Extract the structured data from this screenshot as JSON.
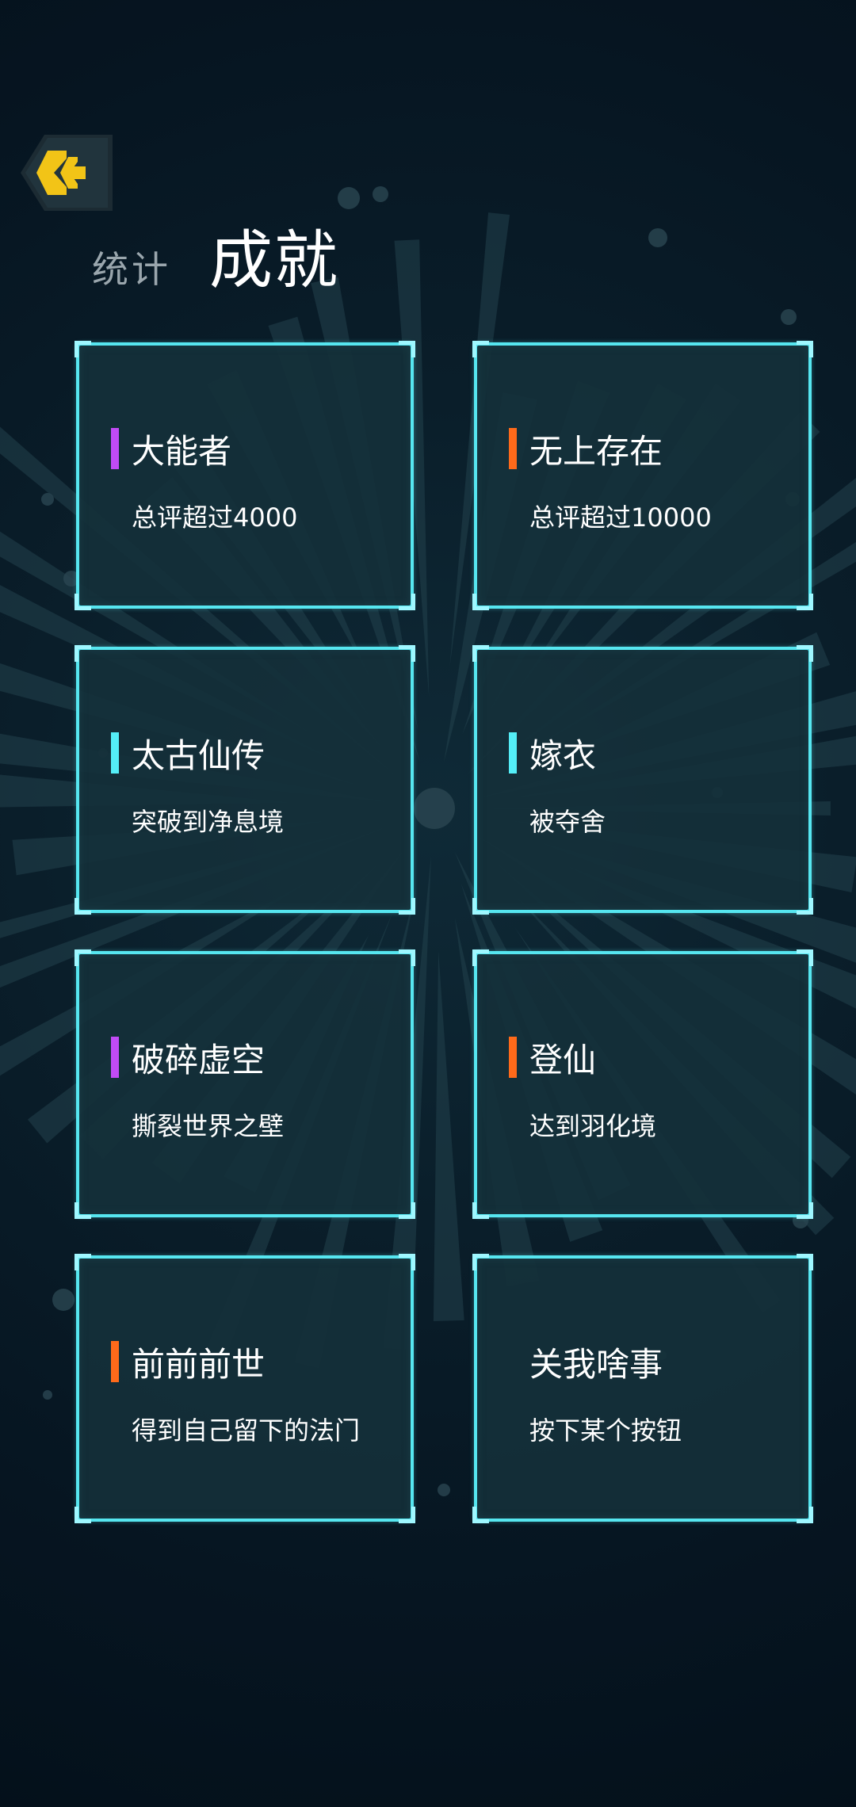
{
  "header": {
    "tabs": [
      {
        "label": "统计",
        "active": false
      },
      {
        "label": "成就",
        "active": true
      }
    ],
    "back_icon": "double-chevron-left-icon"
  },
  "colors": {
    "background": "#06141f",
    "card_border": "#56e6f0",
    "card_fill": "#15303a",
    "back_button": "#f2c417",
    "tier_purple": "#c14bf5",
    "tier_orange": "#ff6a1a",
    "tier_cyan": "#54eef7"
  },
  "achievements": [
    {
      "title": "大能者",
      "description": "总评超过4000",
      "tier_color": "#c14bf5"
    },
    {
      "title": "无上存在",
      "description": "总评超过10000",
      "tier_color": "#ff6a1a"
    },
    {
      "title": "太古仙传",
      "description": "突破到净息境",
      "tier_color": "#54eef7"
    },
    {
      "title": "嫁衣",
      "description": "被夺舍",
      "tier_color": "#54eef7"
    },
    {
      "title": "破碎虚空",
      "description": "撕裂世界之壁",
      "tier_color": "#c14bf5"
    },
    {
      "title": "登仙",
      "description": "达到羽化境",
      "tier_color": "#ff6a1a"
    },
    {
      "title": "前前前世",
      "description": "得到自己留下的法门",
      "tier_color": "#ff6a1a"
    },
    {
      "title": "关我啥事",
      "description": "按下某个按钮",
      "tier_color": ""
    }
  ]
}
